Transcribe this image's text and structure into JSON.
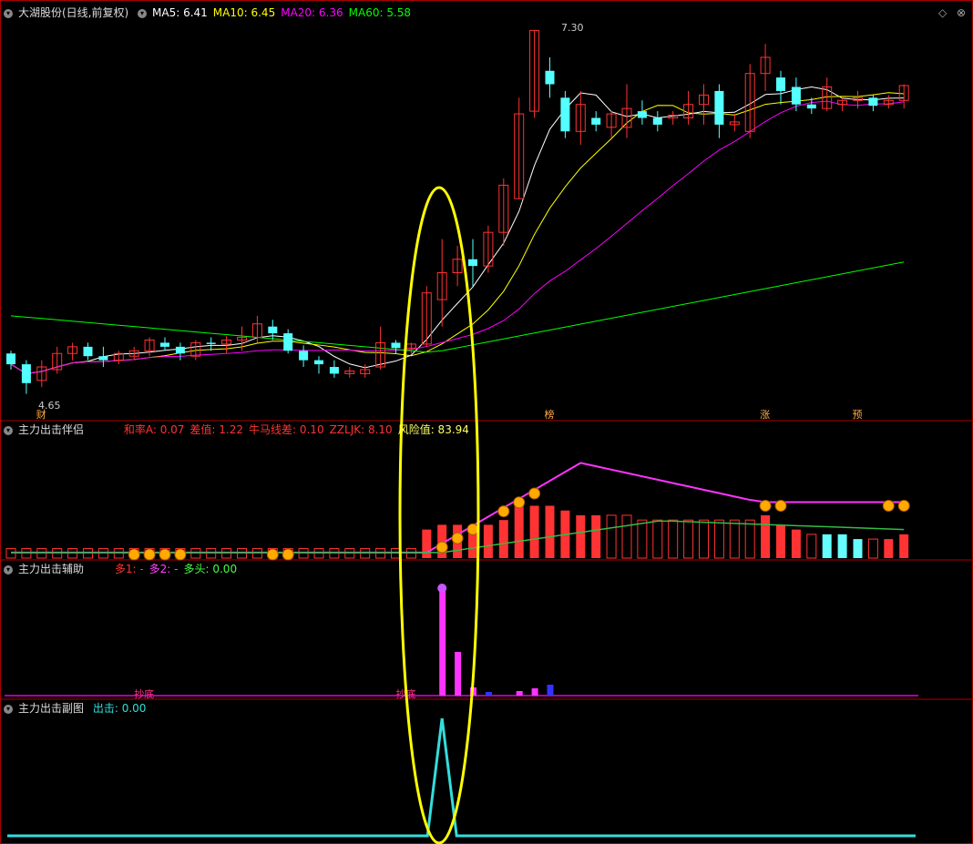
{
  "main_panel": {
    "title": "大湖股份(日线,前复权)",
    "ma_values": [
      {
        "label": "MA5",
        "value": "6.41",
        "color": "#ffffff"
      },
      {
        "label": "MA10",
        "value": "6.45",
        "color": "#ffff00"
      },
      {
        "label": "MA20",
        "value": "6.36",
        "color": "#ff00ff"
      },
      {
        "label": "MA60",
        "value": "5.58",
        "color": "#00ff00"
      }
    ],
    "price_high_label": "7.30",
    "price_low_label": "4.65",
    "markers": [
      "财",
      "榜",
      "涨",
      "预"
    ]
  },
  "panel2": {
    "title": "主力出击伴侣",
    "values": [
      {
        "label": "和率A",
        "value": "0.07",
        "color": "#ff3333"
      },
      {
        "label": "差值",
        "value": "1.22",
        "color": "#ff3333"
      },
      {
        "label": "牛马线差",
        "value": "0.10",
        "color": "#ff3333"
      },
      {
        "label": "ZZLJK",
        "value": "8.10",
        "color": "#ff3333"
      },
      {
        "label": "风险值",
        "value": "83.94",
        "color": "#ffff66"
      }
    ]
  },
  "panel3": {
    "title": "主力出击辅助",
    "values": [
      {
        "label": "多1",
        "value": "-",
        "color": "#ff3333"
      },
      {
        "label": "多2",
        "value": "-",
        "color": "#ff44ff"
      },
      {
        "label": "多头",
        "value": "0.00",
        "color": "#44ff44"
      }
    ],
    "labels": [
      "抄底",
      "抄底"
    ]
  },
  "panel4": {
    "title": "主力出击副图",
    "values": [
      {
        "label": "出击",
        "value": "0.00",
        "color": "#33dddd"
      }
    ]
  },
  "chart_data": {
    "type": "candlestick",
    "series": [
      {
        "name": "MA5",
        "color": "#ffffff"
      },
      {
        "name": "MA10",
        "color": "#ffff00"
      },
      {
        "name": "MA20",
        "color": "#ff00ff"
      },
      {
        "name": "MA60",
        "color": "#00ff00"
      }
    ],
    "ohlc": [
      [
        4.9,
        4.92,
        4.78,
        4.82
      ],
      [
        4.82,
        4.85,
        4.6,
        4.68
      ],
      [
        4.7,
        4.85,
        4.65,
        4.8
      ],
      [
        4.78,
        4.95,
        4.75,
        4.9
      ],
      [
        4.9,
        4.98,
        4.85,
        4.95
      ],
      [
        4.95,
        4.98,
        4.85,
        4.88
      ],
      [
        4.88,
        4.95,
        4.8,
        4.85
      ],
      [
        4.85,
        4.92,
        4.82,
        4.9
      ],
      [
        4.88,
        4.95,
        4.85,
        4.92
      ],
      [
        4.92,
        5.02,
        4.88,
        5.0
      ],
      [
        4.98,
        5.02,
        4.92,
        4.95
      ],
      [
        4.95,
        4.98,
        4.85,
        4.9
      ],
      [
        4.88,
        5.0,
        4.85,
        4.98
      ],
      [
        4.98,
        5.02,
        4.92,
        4.97
      ],
      [
        4.97,
        5.03,
        4.9,
        5.0
      ],
      [
        5.0,
        5.1,
        4.92,
        5.02
      ],
      [
        5.02,
        5.18,
        4.98,
        5.12
      ],
      [
        5.1,
        5.15,
        5.0,
        5.05
      ],
      [
        5.05,
        5.08,
        4.9,
        4.92
      ],
      [
        4.92,
        4.96,
        4.8,
        4.85
      ],
      [
        4.85,
        4.88,
        4.75,
        4.82
      ],
      [
        4.8,
        4.85,
        4.72,
        4.75
      ],
      [
        4.75,
        4.8,
        4.72,
        4.77
      ],
      [
        4.75,
        4.82,
        4.72,
        4.78
      ],
      [
        4.8,
        5.1,
        4.78,
        4.98
      ],
      [
        4.98,
        5.0,
        4.9,
        4.94
      ],
      [
        4.94,
        4.98,
        4.9,
        4.97
      ],
      [
        4.97,
        5.4,
        4.95,
        5.35
      ],
      [
        5.3,
        5.75,
        5.1,
        5.5
      ],
      [
        5.5,
        5.7,
        5.4,
        5.6
      ],
      [
        5.6,
        5.75,
        5.4,
        5.55
      ],
      [
        5.55,
        5.85,
        5.5,
        5.8
      ],
      [
        5.8,
        6.2,
        5.7,
        6.15
      ],
      [
        6.05,
        6.8,
        6.05,
        6.68
      ],
      [
        6.7,
        7.3,
        6.65,
        7.3
      ],
      [
        7.0,
        7.1,
        6.8,
        6.9
      ],
      [
        6.8,
        6.85,
        6.5,
        6.55
      ],
      [
        6.55,
        6.85,
        6.45,
        6.75
      ],
      [
        6.65,
        6.7,
        6.55,
        6.6
      ],
      [
        6.58,
        6.7,
        6.5,
        6.68
      ],
      [
        6.58,
        6.9,
        6.5,
        6.72
      ],
      [
        6.7,
        6.78,
        6.6,
        6.65
      ],
      [
        6.65,
        6.7,
        6.55,
        6.6
      ],
      [
        6.65,
        6.7,
        6.6,
        6.67
      ],
      [
        6.65,
        6.85,
        6.6,
        6.75
      ],
      [
        6.75,
        6.9,
        6.6,
        6.82
      ],
      [
        6.85,
        6.9,
        6.5,
        6.6
      ],
      [
        6.6,
        6.68,
        6.55,
        6.62
      ],
      [
        6.55,
        7.05,
        6.5,
        6.98
      ],
      [
        6.98,
        7.2,
        6.85,
        7.1
      ],
      [
        6.95,
        7.0,
        6.75,
        6.85
      ],
      [
        6.88,
        6.95,
        6.7,
        6.75
      ],
      [
        6.75,
        6.8,
        6.68,
        6.72
      ],
      [
        6.72,
        6.95,
        6.7,
        6.88
      ],
      [
        6.75,
        6.8,
        6.7,
        6.78
      ],
      [
        6.78,
        6.85,
        6.72,
        6.8
      ],
      [
        6.8,
        6.82,
        6.7,
        6.74
      ],
      [
        6.75,
        6.82,
        6.72,
        6.78
      ],
      [
        6.78,
        6.9,
        6.72,
        6.89
      ]
    ],
    "volume_bars": [
      0.1,
      0.1,
      0.1,
      0.1,
      0.1,
      0.1,
      0.1,
      0.1,
      0.1,
      0.1,
      0.1,
      0.1,
      0.1,
      0.1,
      0.1,
      0.1,
      0.1,
      0.1,
      0.1,
      0.1,
      0.1,
      0.1,
      0.1,
      0.1,
      0.1,
      0.1,
      0.1,
      0.3,
      0.35,
      0.35,
      0.3,
      0.35,
      0.4,
      0.6,
      0.55,
      0.55,
      0.5,
      0.45,
      0.45,
      0.45,
      0.45,
      0.4,
      0.4,
      0.4,
      0.4,
      0.4,
      0.4,
      0.4,
      0.4,
      0.45,
      0.35,
      0.3,
      0.25,
      0.25,
      0.25,
      0.2,
      0.2,
      0.2,
      0.25
    ],
    "spike_at_index": 28
  }
}
